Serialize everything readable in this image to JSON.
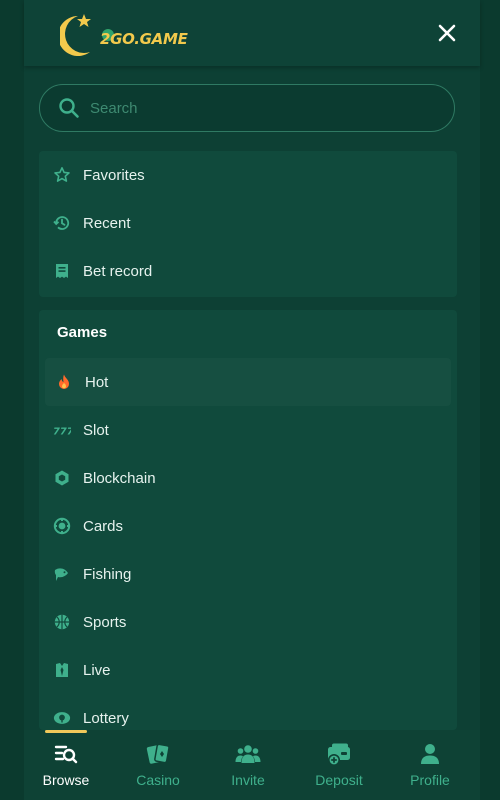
{
  "header": {
    "logo_text": "2GO.GAME",
    "close_icon": "close-icon"
  },
  "search": {
    "placeholder": "Search",
    "value": "",
    "icon": "search-icon"
  },
  "quick_links": [
    {
      "label": "Favorites",
      "icon": "star-icon"
    },
    {
      "label": "Recent",
      "icon": "history-icon"
    },
    {
      "label": "Bet record",
      "icon": "receipt-icon"
    }
  ],
  "games": {
    "title": "Games",
    "items": [
      {
        "label": "Hot",
        "icon": "flame-icon",
        "active": true
      },
      {
        "label": "Slot",
        "icon": "slot-777-icon"
      },
      {
        "label": "Blockchain",
        "icon": "blockchain-icon"
      },
      {
        "label": "Cards",
        "icon": "poker-chip-icon"
      },
      {
        "label": "Fishing",
        "icon": "fish-icon"
      },
      {
        "label": "Sports",
        "icon": "basketball-icon"
      },
      {
        "label": "Live",
        "icon": "live-dealer-icon"
      },
      {
        "label": "Lottery",
        "icon": "lottery-icon"
      }
    ]
  },
  "bottom_nav": {
    "items": [
      {
        "label": "Browse",
        "icon": "browse-icon",
        "active": true
      },
      {
        "label": "Casino",
        "icon": "cards-icon"
      },
      {
        "label": "Invite",
        "icon": "users-icon"
      },
      {
        "label": "Deposit",
        "icon": "wallet-add-icon"
      },
      {
        "label": "Profile",
        "icon": "user-icon"
      }
    ]
  },
  "colors": {
    "background": "#0f4234",
    "panel": "#104a3c",
    "accent": "#3fb08c",
    "active_bar": "#f0c85a",
    "logo_gold": "#f2c94c",
    "hot_flame": "#ff6a2b"
  }
}
